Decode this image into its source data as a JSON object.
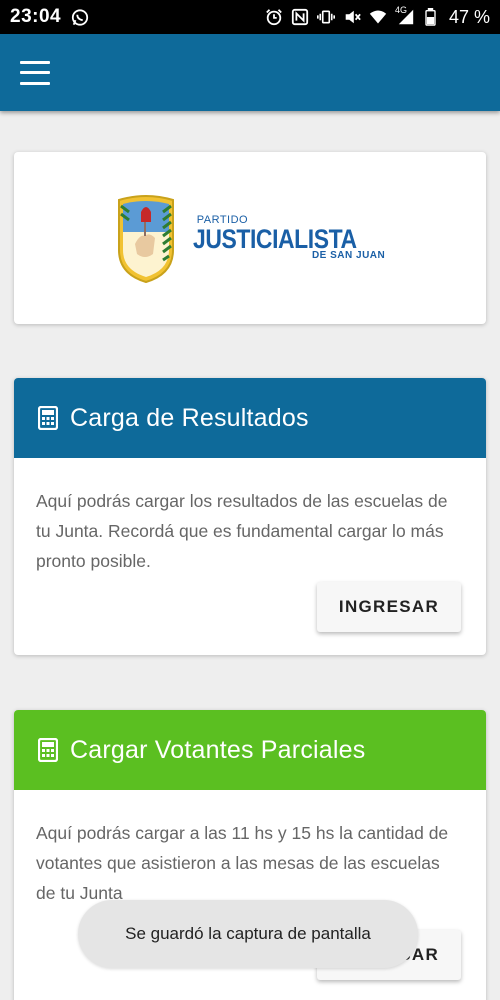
{
  "status_bar": {
    "time": "23:04",
    "network": "4G",
    "battery": "47 %"
  },
  "app_bar": {
    "menu_icon": "hamburger-menu-icon"
  },
  "logo": {
    "line1": "PARTIDO",
    "line2": "JUSTICIALISTA",
    "line3": "DE SAN JUAN"
  },
  "cards": {
    "resultados": {
      "title": "Carga de Resultados",
      "body": "Aquí podrás cargar los resultados de las escuelas de tu Junta. Recordá que es fundamental cargar lo más pronto posible.",
      "button": "INGRESAR",
      "header_color": "#0e6a9a",
      "icon": "calculator-icon"
    },
    "votantes": {
      "title": "Cargar Votantes Parciales",
      "body": "Aquí podrás cargar a las 11 hs y 15 hs la cantidad de votantes que asistieron a las mesas de las escuelas de tu Junta",
      "button": "INGRESAR",
      "header_color": "#5bbf21",
      "icon": "calculator-icon"
    }
  },
  "toast": {
    "text": "Se guardó la captura de pantalla"
  }
}
